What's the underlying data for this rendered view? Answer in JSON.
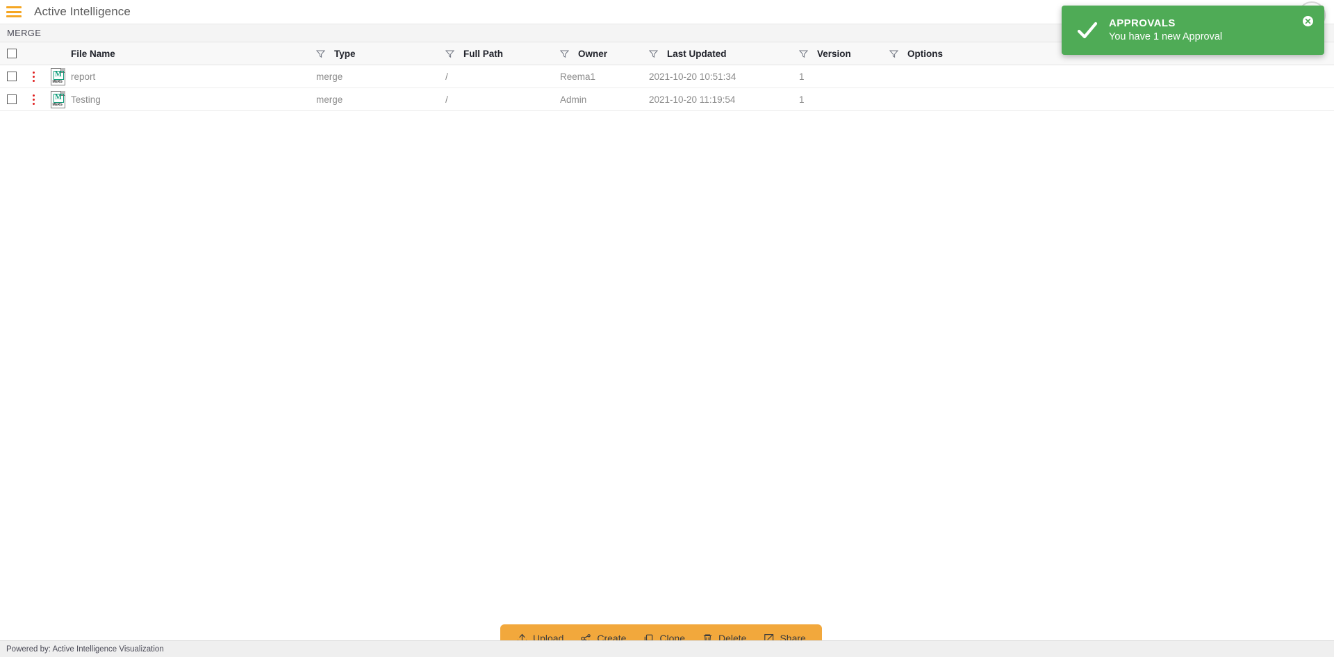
{
  "header": {
    "menu_icon": "hamburger-menu-icon",
    "app_title": "Active Intelligence"
  },
  "breadcrumb": {
    "current": "MERGE"
  },
  "table": {
    "columns": [
      {
        "key": "file_name",
        "label": "File Name",
        "has_filter": true
      },
      {
        "key": "type",
        "label": "Type",
        "has_filter": true
      },
      {
        "key": "full_path",
        "label": "Full Path",
        "has_filter": true
      },
      {
        "key": "owner",
        "label": "Owner",
        "has_filter": true
      },
      {
        "key": "last_updated",
        "label": "Last Updated",
        "has_filter": true
      },
      {
        "key": "version",
        "label": "Version",
        "has_filter": true
      },
      {
        "key": "options",
        "label": "Options",
        "has_filter": true
      }
    ],
    "select_all_checked": false,
    "rows": [
      {
        "checked": false,
        "menu_icon": "kebab-menu-icon",
        "file_icon": "merge-file-icon",
        "file_icon_letter": "M",
        "file_icon_tag": "MERG",
        "file_name": "report",
        "type": "merge",
        "full_path": "/",
        "owner": "Reema1",
        "last_updated": "2021-10-20 10:51:34",
        "version": "1",
        "options": ""
      },
      {
        "checked": false,
        "menu_icon": "kebab-menu-icon",
        "file_icon": "merge-file-icon",
        "file_icon_letter": "M",
        "file_icon_tag": "MERG",
        "file_name": "Testing",
        "type": "merge",
        "full_path": "/",
        "owner": "Admin",
        "last_updated": "2021-10-20 11:19:54",
        "version": "1",
        "options": ""
      }
    ]
  },
  "action_bar": {
    "buttons": [
      {
        "icon": "upload-icon",
        "label": "Upload"
      },
      {
        "icon": "create-node-icon",
        "label": "Create"
      },
      {
        "icon": "clone-icon",
        "label": "Clone"
      },
      {
        "icon": "trash-icon",
        "label": "Delete"
      },
      {
        "icon": "share-icon",
        "label": "Share"
      }
    ]
  },
  "toast": {
    "icon": "checkmark-icon",
    "title": "APPROVALS",
    "message": "You have 1 new Approval",
    "close_icon": "close-circle-icon",
    "background_color": "#4fab56"
  },
  "footer": {
    "text": "Powered by: Active Intelligence Visualization"
  },
  "colors": {
    "accent": "#f2a83c",
    "hamburger": "#f5a623",
    "success": "#4fab56",
    "kebab": "#e02020",
    "icon_green": "#0f9d7a"
  }
}
